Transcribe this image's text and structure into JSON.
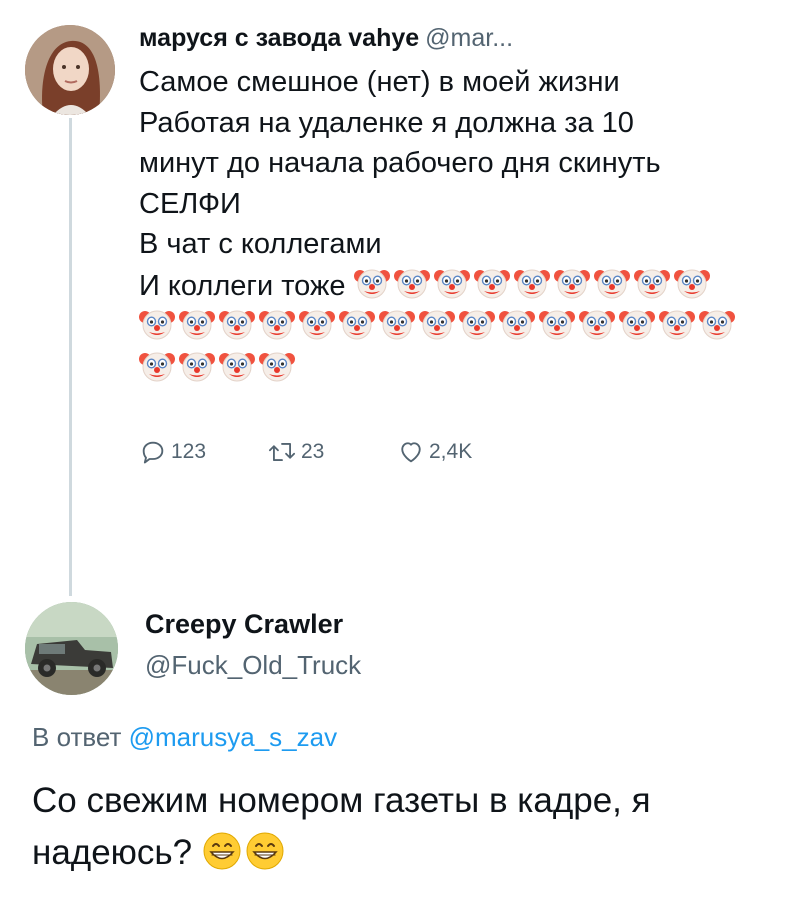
{
  "tweet": {
    "author_name": "маруся с завода vahye",
    "author_handle": "@mar...",
    "lines": [
      "Самое смешное (нет) в моей жизни",
      "Работая на удаленке я должна за 10",
      "минут до начала рабочего дня скинуть",
      "СЕЛФИ",
      "В чат с коллегами",
      "И коллеги тоже"
    ],
    "clown_emoji_rows": [
      9,
      15,
      4
    ],
    "emoji": "clown-face-emoji",
    "replies": "123",
    "retweets": "23",
    "likes": "2,4K"
  },
  "reply": {
    "author_name": "Creepy Crawler",
    "author_handle": "@Fuck_Old_Truck",
    "reply_to_prefix": "В ответ",
    "reply_to_handle": "@marusya_s_zav",
    "text": "Со свежим номером газеты в кадре, я надеюсь?",
    "emoji": "grinning-face-emoji",
    "emoji_count": 2
  },
  "colors": {
    "text": "#0f1419",
    "secondary": "#536471",
    "link": "#1d9bf0",
    "thread_line": "#cfd9de"
  }
}
